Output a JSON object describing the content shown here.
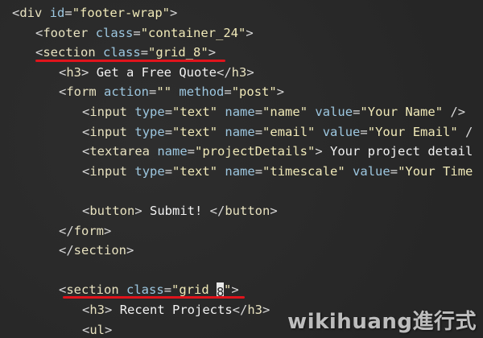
{
  "editor": {
    "lines": [
      {
        "indent": 1,
        "tokens": [
          [
            "p",
            "<"
          ],
          [
            "tag",
            "div"
          ],
          [
            "p",
            " "
          ],
          [
            "attr",
            "id"
          ],
          [
            "p",
            "="
          ],
          [
            "str",
            "\"footer-wrap\""
          ],
          [
            "p",
            ">"
          ]
        ]
      },
      {
        "indent": 2,
        "tokens": [
          [
            "p",
            "<"
          ],
          [
            "tag",
            "footer"
          ],
          [
            "p",
            " "
          ],
          [
            "attr",
            "class"
          ],
          [
            "p",
            "="
          ],
          [
            "str",
            "\"container_24\""
          ],
          [
            "p",
            ">"
          ]
        ]
      },
      {
        "indent": 2,
        "tokens": [
          [
            "p",
            "<"
          ],
          [
            "tag",
            "section"
          ],
          [
            "p",
            " "
          ],
          [
            "attr",
            "class"
          ],
          [
            "p",
            "="
          ],
          [
            "str",
            "\"grid_8\""
          ],
          [
            "p",
            ">"
          ]
        ]
      },
      {
        "indent": 3,
        "tokens": [
          [
            "p",
            "<"
          ],
          [
            "tag",
            "h3"
          ],
          [
            "p",
            "> "
          ],
          [
            "txt",
            "Get a Free Quote"
          ],
          [
            "p",
            "</"
          ],
          [
            "tag",
            "h3"
          ],
          [
            "p",
            ">"
          ]
        ]
      },
      {
        "indent": 3,
        "tokens": [
          [
            "p",
            "<"
          ],
          [
            "tag",
            "form"
          ],
          [
            "p",
            " "
          ],
          [
            "attr",
            "action"
          ],
          [
            "p",
            "="
          ],
          [
            "str",
            "\"\""
          ],
          [
            "p",
            " "
          ],
          [
            "attr",
            "method"
          ],
          [
            "p",
            "="
          ],
          [
            "str",
            "\"post\""
          ],
          [
            "p",
            ">"
          ]
        ]
      },
      {
        "indent": 4,
        "tokens": [
          [
            "p",
            "<"
          ],
          [
            "tag",
            "input"
          ],
          [
            "p",
            " "
          ],
          [
            "attr",
            "type"
          ],
          [
            "p",
            "="
          ],
          [
            "str",
            "\"text\""
          ],
          [
            "p",
            " "
          ],
          [
            "attr",
            "name"
          ],
          [
            "p",
            "="
          ],
          [
            "str",
            "\"name\""
          ],
          [
            "p",
            " "
          ],
          [
            "attr",
            "value"
          ],
          [
            "p",
            "="
          ],
          [
            "str",
            "\"Your Name\""
          ],
          [
            "p",
            " />"
          ]
        ]
      },
      {
        "indent": 4,
        "tokens": [
          [
            "p",
            "<"
          ],
          [
            "tag",
            "input"
          ],
          [
            "p",
            " "
          ],
          [
            "attr",
            "type"
          ],
          [
            "p",
            "="
          ],
          [
            "str",
            "\"text\""
          ],
          [
            "p",
            " "
          ],
          [
            "attr",
            "name"
          ],
          [
            "p",
            "="
          ],
          [
            "str",
            "\"email\""
          ],
          [
            "p",
            " "
          ],
          [
            "attr",
            "value"
          ],
          [
            "p",
            "="
          ],
          [
            "str",
            "\"Your Email\""
          ],
          [
            "p",
            " /"
          ]
        ]
      },
      {
        "indent": 4,
        "tokens": [
          [
            "p",
            "<"
          ],
          [
            "tag",
            "textarea"
          ],
          [
            "p",
            " "
          ],
          [
            "attr",
            "name"
          ],
          [
            "p",
            "="
          ],
          [
            "str",
            "\"projectDetails\""
          ],
          [
            "p",
            "> "
          ],
          [
            "txt",
            "Your project detail"
          ]
        ]
      },
      {
        "indent": 4,
        "tokens": [
          [
            "p",
            "<"
          ],
          [
            "tag",
            "input"
          ],
          [
            "p",
            " "
          ],
          [
            "attr",
            "type"
          ],
          [
            "p",
            "="
          ],
          [
            "str",
            "\"text\""
          ],
          [
            "p",
            " "
          ],
          [
            "attr",
            "name"
          ],
          [
            "p",
            "="
          ],
          [
            "str",
            "\"timescale\""
          ],
          [
            "p",
            " "
          ],
          [
            "attr",
            "value"
          ],
          [
            "p",
            "="
          ],
          [
            "str",
            "\"Your Time"
          ]
        ]
      },
      {
        "indent": 0,
        "tokens": []
      },
      {
        "indent": 4,
        "tokens": [
          [
            "p",
            "<"
          ],
          [
            "tag",
            "button"
          ],
          [
            "p",
            "> "
          ],
          [
            "txt",
            "Submit! "
          ],
          [
            "p",
            "</"
          ],
          [
            "tag",
            "button"
          ],
          [
            "p",
            ">"
          ]
        ]
      },
      {
        "indent": 3,
        "tokens": [
          [
            "p",
            "</"
          ],
          [
            "tag",
            "form"
          ],
          [
            "p",
            ">"
          ]
        ]
      },
      {
        "indent": 3,
        "tokens": [
          [
            "p",
            "</"
          ],
          [
            "tag",
            "section"
          ],
          [
            "p",
            ">"
          ]
        ]
      },
      {
        "indent": 0,
        "tokens": []
      },
      {
        "indent": 3,
        "tokens": [
          [
            "p",
            "<"
          ],
          [
            "tag",
            "section"
          ],
          [
            "p",
            " "
          ],
          [
            "attr",
            "class"
          ],
          [
            "p",
            "="
          ],
          [
            "str",
            "\"grid_"
          ],
          [
            "cursor",
            "8"
          ],
          [
            "str",
            "\""
          ],
          [
            "p",
            ">"
          ]
        ]
      },
      {
        "indent": 4,
        "tokens": [
          [
            "p",
            "<"
          ],
          [
            "tag",
            "h3"
          ],
          [
            "p",
            "> "
          ],
          [
            "txt",
            "Recent Projects"
          ],
          [
            "p",
            "</"
          ],
          [
            "tag",
            "h3"
          ],
          [
            "p",
            ">"
          ]
        ]
      },
      {
        "indent": 4,
        "tokens": [
          [
            "p",
            "<"
          ],
          [
            "tag",
            "ul"
          ],
          [
            "p",
            ">"
          ]
        ]
      }
    ],
    "highlight_color": "#e0141c"
  },
  "watermark": {
    "text": "wikihuang進行式"
  }
}
